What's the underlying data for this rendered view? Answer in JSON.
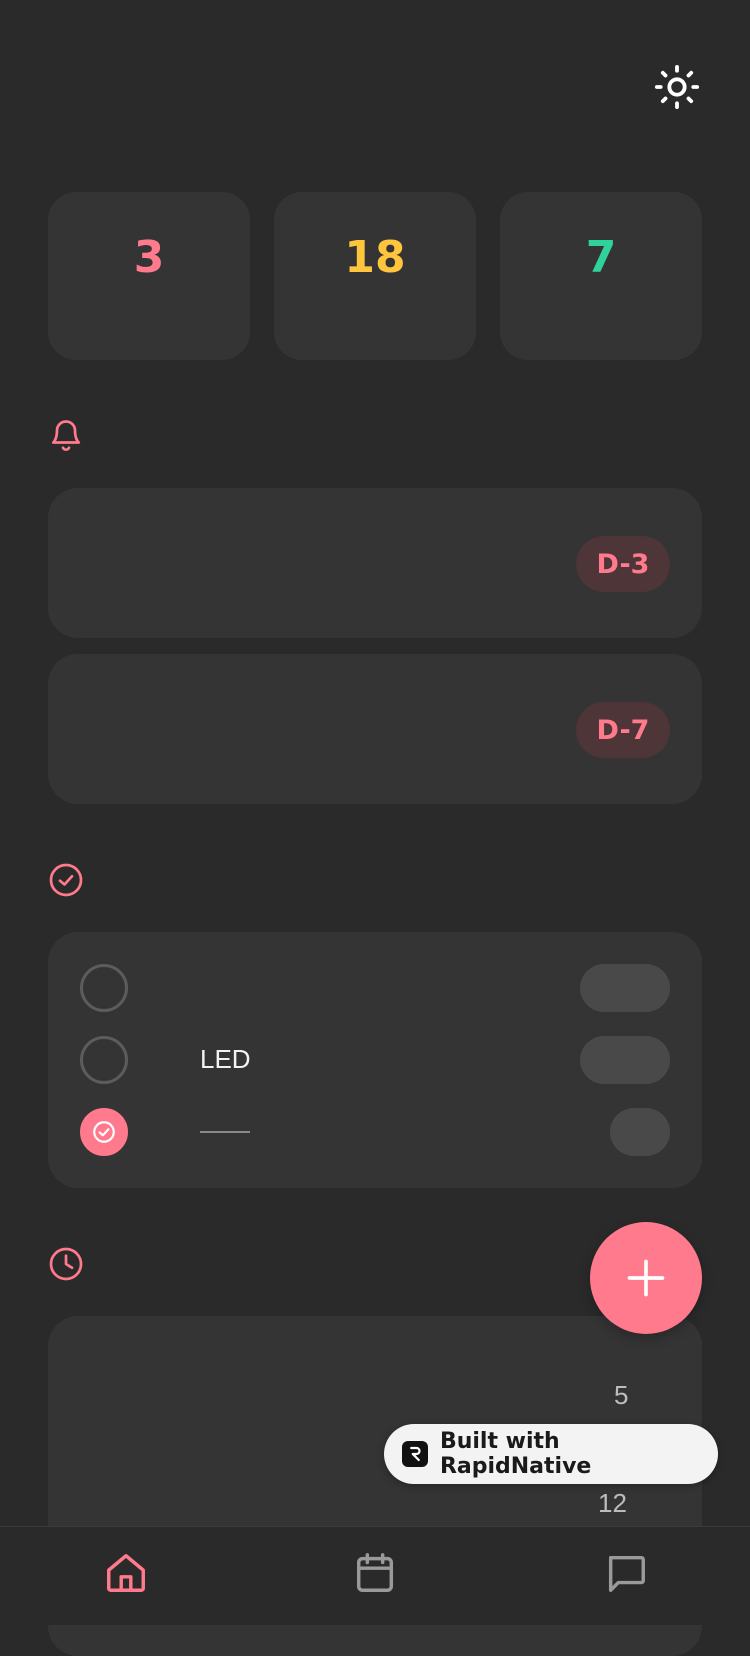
{
  "stats": [
    {
      "value": "3",
      "color": "#ff7a8c"
    },
    {
      "value": "18",
      "color": "#ffc53d"
    },
    {
      "value": "7",
      "color": "#2fd29a"
    }
  ],
  "reminders": [
    {
      "badge": "D-3"
    },
    {
      "badge": "D-7"
    }
  ],
  "checklist": [
    {
      "label": "",
      "done": false
    },
    {
      "label": "LED",
      "done": false
    },
    {
      "label": "",
      "done": true
    }
  ],
  "history": {
    "values": [
      "5",
      "12"
    ]
  },
  "branding": {
    "built_with": "Built with RapidNative"
  },
  "icons": {
    "theme": "sun-icon",
    "reminders": "bell-icon",
    "checklist": "check-circle-icon",
    "history": "clock-icon",
    "fab": "plus-icon",
    "nav": [
      "home-icon",
      "calendar-icon",
      "chat-icon"
    ]
  },
  "colors": {
    "accent": "#ff7a8c",
    "background": "#2b2a2a",
    "card": "#353434",
    "inactive_icon": "#9a9a9a"
  }
}
